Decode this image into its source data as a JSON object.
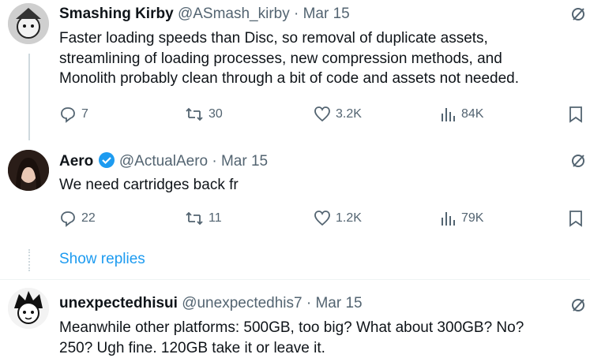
{
  "tweets": [
    {
      "name": "Smashing Kirby",
      "handle": "@ASmash_kirby",
      "sep": "·",
      "date": "Mar 15",
      "text_lines": [
        "Faster loading speeds than Disc, so removal of duplicate assets,",
        "streamlining of loading processes, new compression methods, and",
        "Monolith probably clean through a bit of code and assets not needed."
      ],
      "replies": "7",
      "reposts": "30",
      "likes": "3.2K",
      "views": "84K"
    },
    {
      "name": "Aero",
      "handle": "@ActualAero",
      "sep": "·",
      "date": "Mar 15",
      "text_lines": [
        "We need cartridges back fr"
      ],
      "replies": "22",
      "reposts": "11",
      "likes": "1.2K",
      "views": "79K"
    },
    {
      "name": "unexpectedhisui",
      "handle": "@unexpectedhis7",
      "sep": "·",
      "date": "Mar 15",
      "text_lines": [
        "Meanwhile other platforms: 500GB, too big? What about 300GB? No?",
        "250? Ugh fine. 120GB take it or leave it."
      ]
    }
  ],
  "show_replies": "Show replies",
  "colors": {
    "accent": "#1d9bf0",
    "muted": "#536471",
    "verified": "#1d9bf0"
  }
}
